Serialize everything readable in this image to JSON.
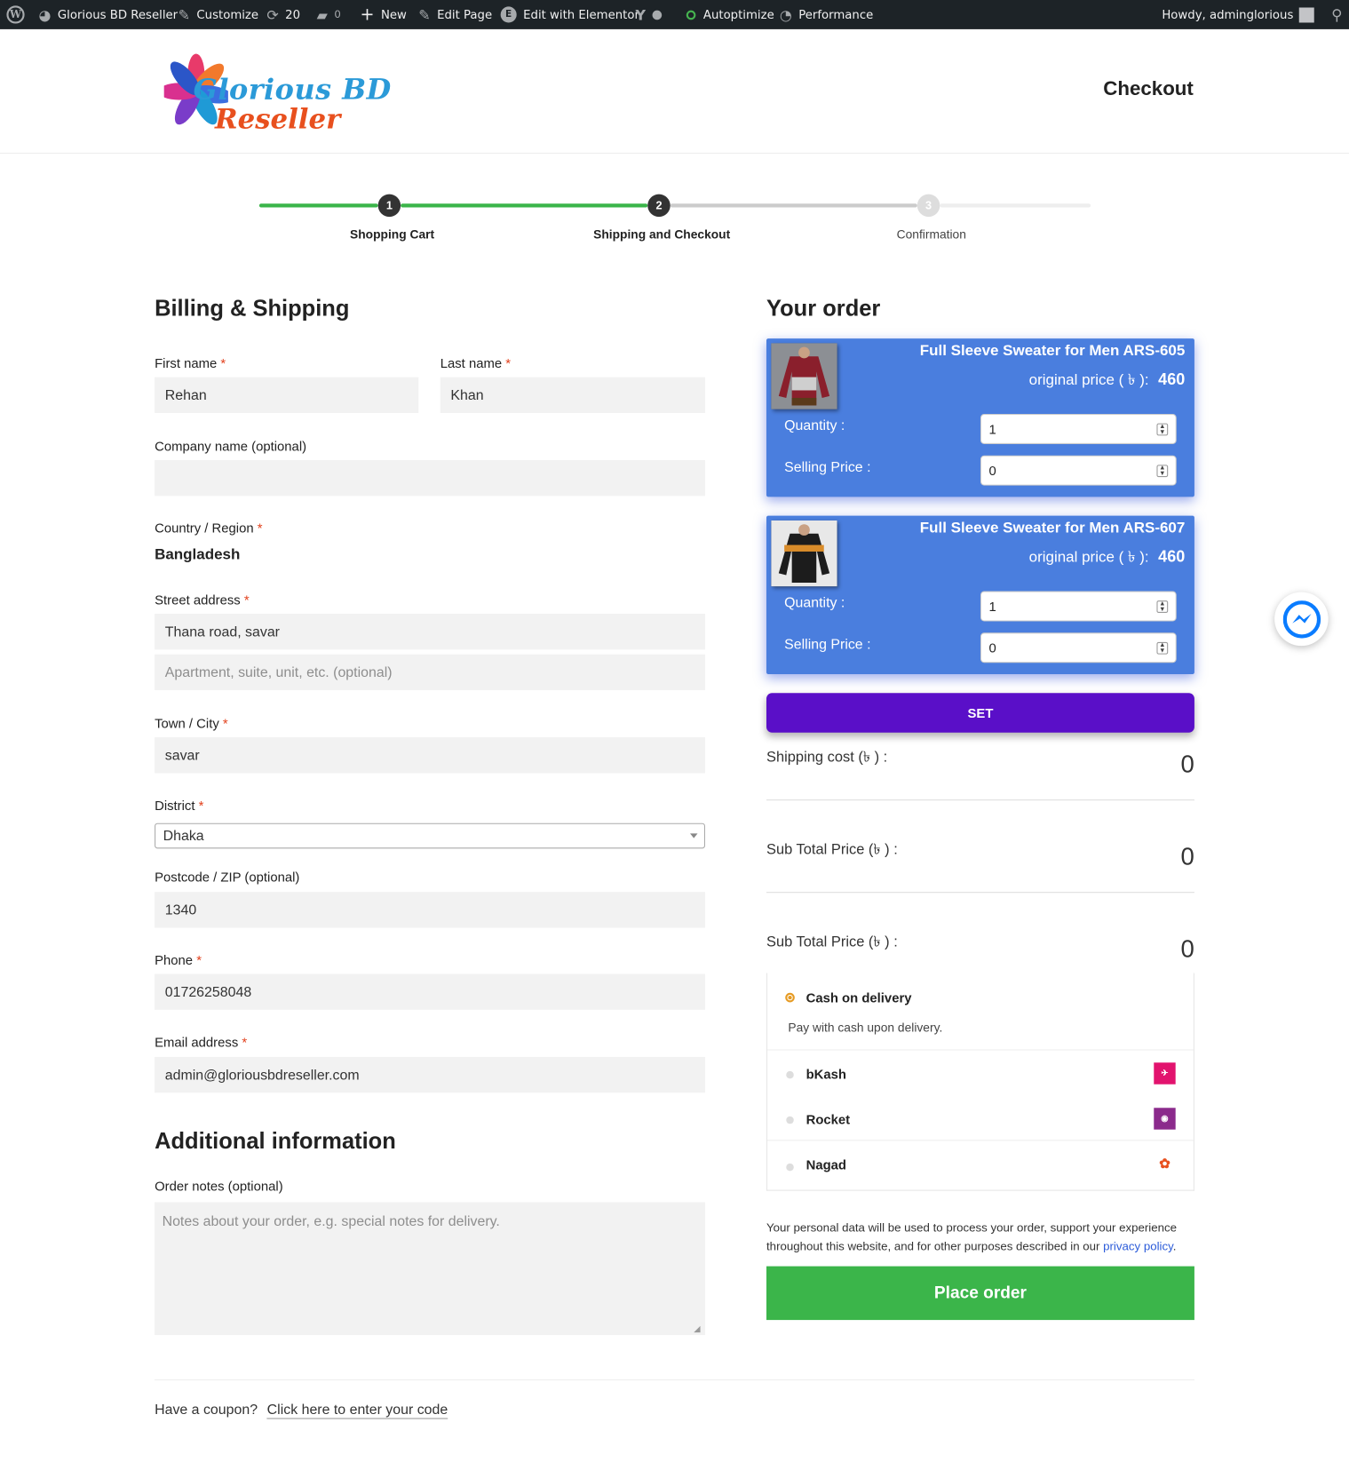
{
  "adminbar": {
    "site_name": "Glorious BD Reseller",
    "customize": "Customize",
    "updates_count": "20",
    "comments_count": "0",
    "new": "New",
    "edit_page": "Edit Page",
    "edit_elementor": "Edit with Elementor",
    "autoptimize": "Autoptimize",
    "performance": "Performance",
    "howdy": "Howdy, adminglorious"
  },
  "header": {
    "logo_line1": "Glorious BD",
    "logo_line2": "Reseller",
    "page_title": "Checkout"
  },
  "steps": [
    {
      "num": "1",
      "label": "Shopping Cart",
      "state": "done"
    },
    {
      "num": "2",
      "label": "Shipping and Checkout",
      "state": "current"
    },
    {
      "num": "3",
      "label": "Confirmation",
      "state": "todo"
    }
  ],
  "billing": {
    "heading": "Billing & Shipping",
    "first_name_label": "First name",
    "first_name": "Rehan",
    "last_name_label": "Last name",
    "last_name": "Khan",
    "company_label": "Company name (optional)",
    "company": "",
    "country_label": "Country / Region",
    "country": "Bangladesh",
    "street_label": "Street address",
    "street1": "Thana road, savar",
    "street2_placeholder": "Apartment, suite, unit, etc. (optional)",
    "city_label": "Town / City",
    "city": "savar",
    "district_label": "District",
    "district": "Dhaka",
    "postcode_label": "Postcode / ZIP (optional)",
    "postcode": "1340",
    "phone_label": "Phone",
    "phone": "01726258048",
    "email_label": "Email address",
    "email": "admin@gloriousbdreseller.com",
    "required_mark": "*"
  },
  "additional": {
    "heading": "Additional information",
    "notes_label": "Order notes (optional)",
    "notes_placeholder": "Notes about your order, e.g. special notes for delivery."
  },
  "order": {
    "heading": "Your order",
    "items": [
      {
        "title": "Full Sleeve Sweater for Men ARS-605",
        "price_label": "original price ( ৳ ):",
        "price": "460",
        "qty_label": "Quantity :",
        "qty": "1",
        "sell_label": "Selling Price :",
        "sell": "0"
      },
      {
        "title": "Full Sleeve Sweater for Men ARS-607",
        "price_label": "original price ( ৳ ):",
        "price": "460",
        "qty_label": "Quantity :",
        "qty": "1",
        "sell_label": "Selling Price :",
        "sell": "0"
      }
    ],
    "set_label": "SET",
    "shipping_label": "Shipping cost (৳ ) :",
    "shipping_value": "0",
    "subtotal_label": "Sub Total Price (৳ ) :",
    "subtotal_value": "0",
    "subtotal2_label": "Sub Total Price (৳ ) :",
    "subtotal2_value": "0"
  },
  "payment": {
    "methods": [
      {
        "name": "Cash on delivery",
        "desc": "Pay with cash upon delivery.",
        "selected": true
      },
      {
        "name": "bKash",
        "icon": "bkash-icon"
      },
      {
        "name": "Rocket",
        "icon": "rocket-icon"
      },
      {
        "name": "Nagad",
        "icon": "nagad-icon"
      }
    ],
    "privacy_text": "Your personal data will be used to process your order, support your experience throughout this website, and for other purposes described in our",
    "privacy_link": "privacy policy",
    "privacy_end": ".",
    "place_order": "Place order"
  },
  "coupon": {
    "question": "Have a coupon?",
    "link": "Click here to enter your code"
  },
  "colors": {
    "accent_green": "#3bb54a",
    "card_blue": "#4a7ede",
    "set_purple": "#5a0fc8",
    "required_red": "#e2401c"
  }
}
